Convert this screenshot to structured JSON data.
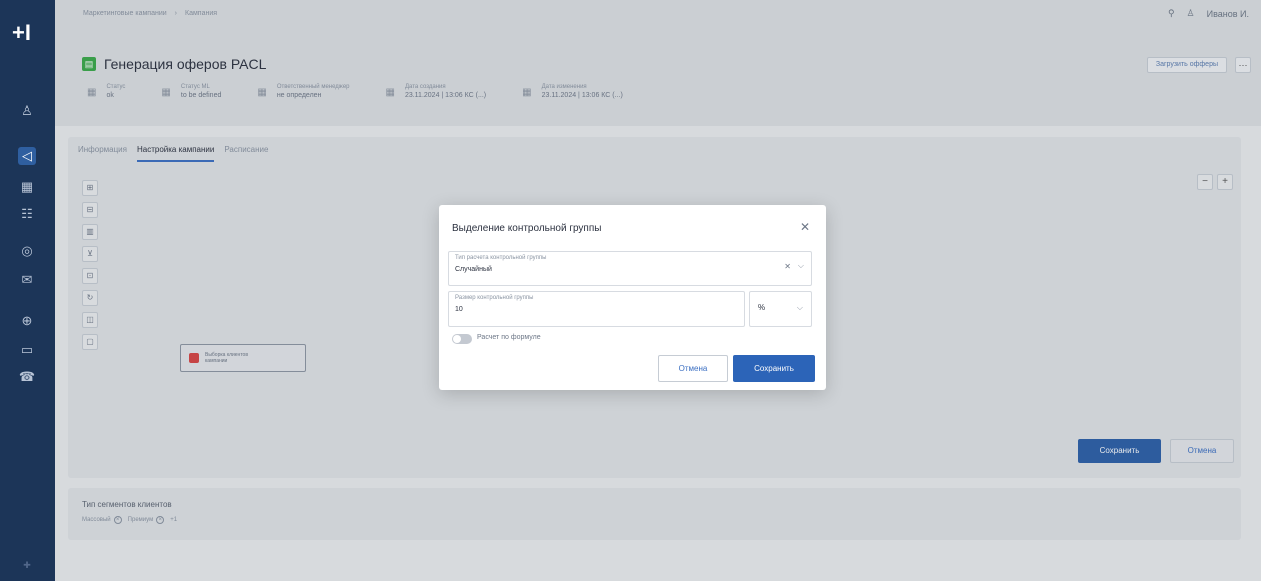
{
  "sidebar": {
    "logo": "+I",
    "icons": [
      {
        "name": "user-icon",
        "glyph": "♙"
      },
      {
        "name": "megaphone-icon",
        "glyph": "◁",
        "active": true
      },
      {
        "name": "grid-icon",
        "glyph": "▦"
      },
      {
        "name": "filter-icon",
        "glyph": "☷"
      },
      {
        "name": "search-people-icon",
        "glyph": "◎"
      },
      {
        "name": "mail-icon",
        "glyph": "✉"
      },
      {
        "name": "globe-icon",
        "glyph": "⊕"
      },
      {
        "name": "message-icon",
        "glyph": "▭"
      },
      {
        "name": "phone-icon",
        "glyph": "☎"
      }
    ],
    "bottom": "✚"
  },
  "header": {
    "breadcrumb": [
      "Маркетинговые кампании",
      "›",
      "Кампания"
    ],
    "search_icon": "⚲",
    "user_icon": "♙",
    "user_name": "Иванов И.",
    "title_badge": "▤",
    "title": "Генерация оферов PACL",
    "load_button": "Загрузить офферы",
    "more_button": "⋯",
    "meta": [
      {
        "label": "Статус",
        "value": "ok"
      },
      {
        "label": "Статус ML",
        "value": "to be defined"
      },
      {
        "label": "Ответственный менеджер",
        "value": "не определен"
      },
      {
        "label": "Дата создания",
        "value": "23.11.2024 | 13:06 КС (...)"
      },
      {
        "label": "Дата изменения",
        "value": "23.11.2024 | 13:06 КС (...)"
      }
    ]
  },
  "tabs": [
    "Информация",
    "Настройка кампании",
    "Расписание"
  ],
  "tools": [
    "⊞",
    "⊟",
    "▥",
    "⊻",
    "⊡",
    "↻",
    "◫",
    "▢"
  ],
  "zoom": {
    "minus": "−",
    "plus": "+"
  },
  "node": {
    "label_line1": "Выборка клиентов",
    "label_line2": "кампании"
  },
  "card_buttons": {
    "save": "Сохранить",
    "cancel": "Отмена"
  },
  "segments": {
    "title": "Тип сегментов клиентов",
    "chips": [
      "Массовый",
      "Премиум",
      "+1"
    ]
  },
  "modal": {
    "title": "Выделение контрольной группы",
    "close": "✕",
    "field1": {
      "label": "Тип расчета контрольной группы",
      "value": "Случайный"
    },
    "field2": {
      "label": "Размер контрольной группы",
      "value": "10"
    },
    "unit": "%",
    "toggle_label": "Расчет по формуле",
    "cancel": "Отмена",
    "save": "Сохранить"
  }
}
